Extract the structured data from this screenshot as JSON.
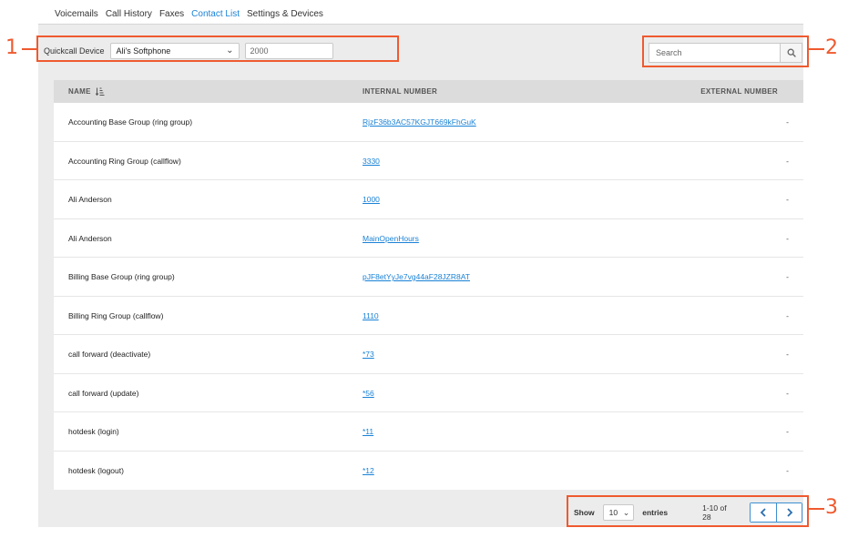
{
  "tabs": [
    {
      "label": "Voicemails"
    },
    {
      "label": "Call History"
    },
    {
      "label": "Faxes"
    },
    {
      "label": "Contact List",
      "active": true
    },
    {
      "label": "Settings & Devices"
    }
  ],
  "quickcall": {
    "label": "Quickcall Device",
    "selected_device": "Ali's Softphone",
    "number_value": "2000"
  },
  "search": {
    "placeholder": "Search",
    "icon": "search-icon"
  },
  "table": {
    "headers": {
      "name": "NAME",
      "internal": "INTERNAL NUMBER",
      "external": "EXTERNAL NUMBER"
    },
    "sort_icon": "sort-ascending-icon",
    "rows": [
      {
        "name": "Accounting Base Group (ring group)",
        "internal": "RjzF36b3AC57KGJT669kFhGuK",
        "external": "-"
      },
      {
        "name": "Accounting Ring Group (callflow)",
        "internal": "3330",
        "external": "-"
      },
      {
        "name": "Ali Anderson",
        "internal": "1000",
        "external": "-"
      },
      {
        "name": "Ali Anderson",
        "internal": "MainOpenHours",
        "external": "-"
      },
      {
        "name": "Billing Base Group (ring group)",
        "internal": "pJF8etYyJe7vg44aF28JZR8AT",
        "external": "-"
      },
      {
        "name": "Billing Ring Group (callflow)",
        "internal": "1110",
        "external": "-"
      },
      {
        "name": "call forward (deactivate)",
        "internal": "*73",
        "external": "-"
      },
      {
        "name": "call forward (update)",
        "internal": "*56",
        "external": "-"
      },
      {
        "name": "hotdesk (login)",
        "internal": "*11",
        "external": "-"
      },
      {
        "name": "hotdesk (logout)",
        "internal": "*12",
        "external": "-"
      }
    ]
  },
  "pagination": {
    "show_label": "Show",
    "page_length": "10",
    "entries_label": "entries",
    "range": "1-10 of 28",
    "prev_icon": "chevron-left-icon",
    "next_icon": "chevron-right-icon"
  },
  "callouts": {
    "one": "1",
    "two": "2",
    "three": "3"
  },
  "colors": {
    "accent": "#1a82d6",
    "callout": "#ef5a2f"
  }
}
